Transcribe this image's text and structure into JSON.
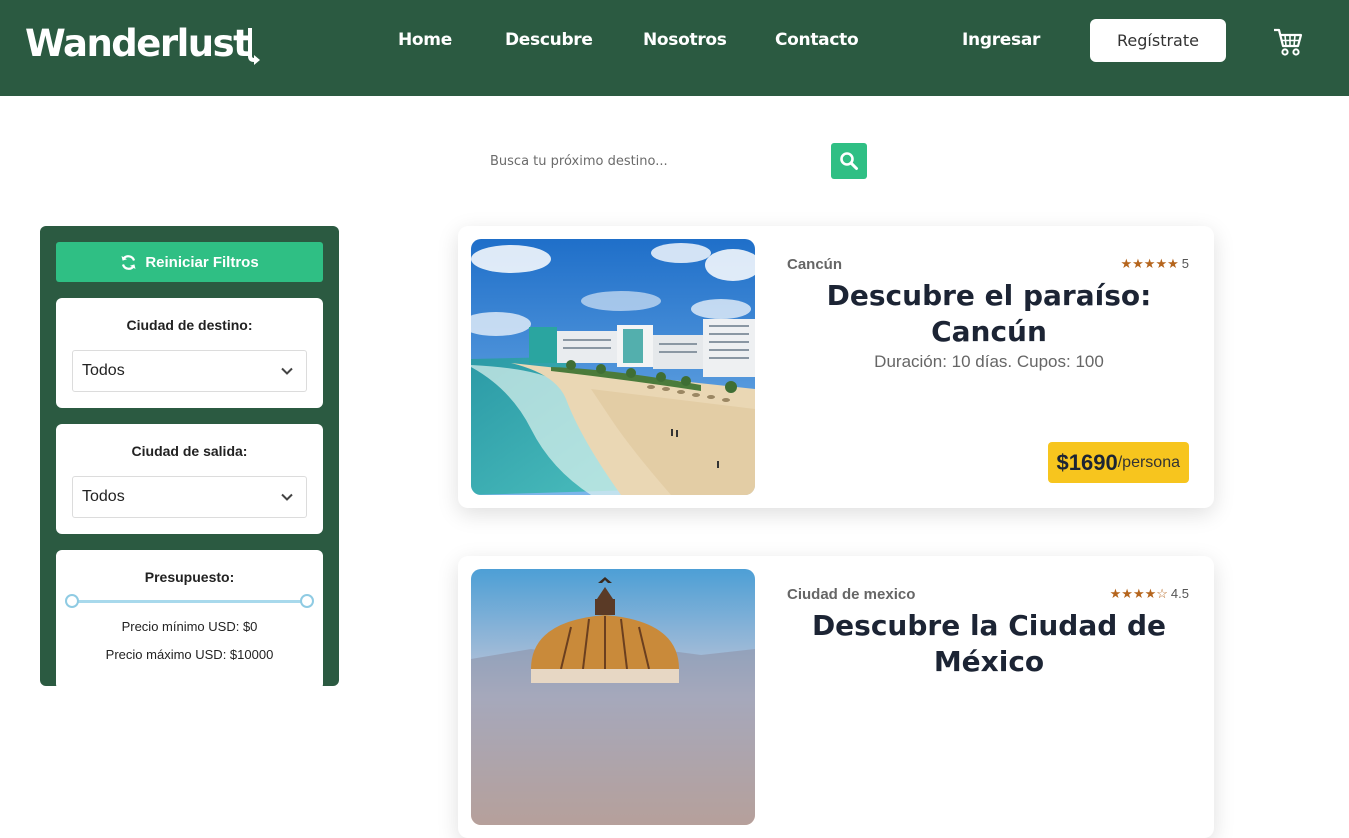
{
  "header": {
    "logo": "Wanderlust",
    "nav": [
      "Home",
      "Descubre",
      "Nosotros",
      "Contacto"
    ],
    "login": "Ingresar",
    "register": "Regístrate"
  },
  "search": {
    "placeholder": "Busca tu próximo destino..."
  },
  "sidebar": {
    "reset_label": "Reiniciar Filtros",
    "destination": {
      "title": "Ciudad de destino:",
      "value": "Todos"
    },
    "departure": {
      "title": "Ciudad de salida:",
      "value": "Todos"
    },
    "budget": {
      "title": "Presupuesto:",
      "min_label": "Precio mínimo USD: $0",
      "max_label": "Precio máximo USD: $10000",
      "min_value": 0,
      "max_value": 10000
    }
  },
  "cards": [
    {
      "city": "Cancún",
      "stars": "★★★★★",
      "rating": "5",
      "title_line1": "Descubre el paraíso:",
      "title_line2": "Cancún",
      "subtitle": "Duración: 10 días. Cupos: 100",
      "price": "$1690",
      "per": "/persona"
    },
    {
      "city": "Ciudad de mexico",
      "stars": "★★★★☆",
      "rating": "4.5",
      "title_line1": "Descubre la Ciudad de",
      "title_line2": "México"
    }
  ],
  "colors": {
    "header_bg": "#2b5a41",
    "accent_green": "#2fbf84",
    "price_badge": "#f7c51e"
  }
}
